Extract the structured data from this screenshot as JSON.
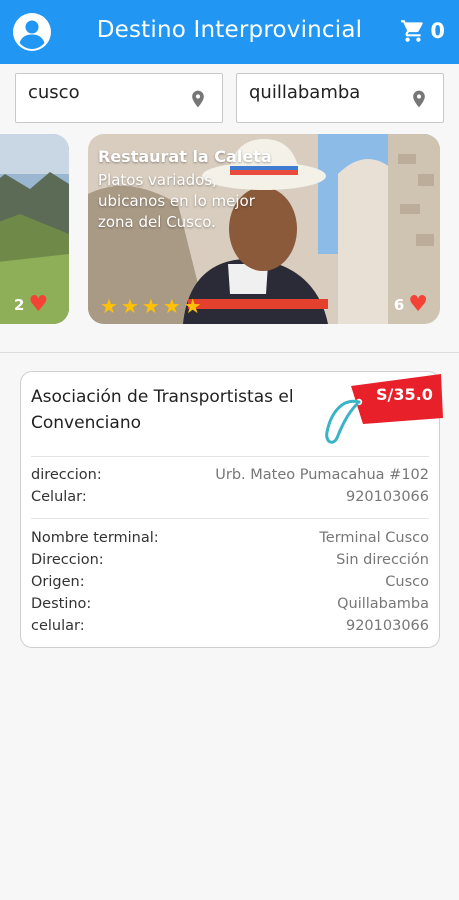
{
  "appbar": {
    "title": "Destino Interprovincial",
    "cart_count": "0",
    "icons": {
      "profile": "account-circle-icon",
      "cart": "cart-icon"
    },
    "color": "#2196f3"
  },
  "search": {
    "origin": "cusco",
    "destination": "quillabamba",
    "icon": "map-pin-icon"
  },
  "carousel": {
    "left_card": {
      "likes": "2"
    },
    "main_card": {
      "title": "Restaurat la Caleta",
      "description": "Platos variados, ubicanos en lo mejor zona del Cusco.",
      "rating": 5,
      "stars": [
        "★",
        "★",
        "★",
        "★",
        "★"
      ],
      "likes": "6"
    },
    "heart_color": "#f44336",
    "star_color": "#ffc107"
  },
  "result": {
    "company": "Asociación de Transportistas el Convenciano",
    "price": "S/35.0",
    "price_color": "#e8202a",
    "contact": [
      {
        "label": "direccion:",
        "value": "Urb. Mateo Pumacahua #102"
      },
      {
        "label": "Celular:",
        "value": "920103066"
      }
    ],
    "terminal": [
      {
        "label": "Nombre terminal:",
        "value": "Terminal Cusco"
      },
      {
        "label": "Direccion:",
        "value": "Sin dirección"
      },
      {
        "label": "Origen:",
        "value": "Cusco"
      },
      {
        "label": "Destino:",
        "value": "Quillabamba"
      },
      {
        "label": "celular:",
        "value": "920103066"
      }
    ]
  }
}
